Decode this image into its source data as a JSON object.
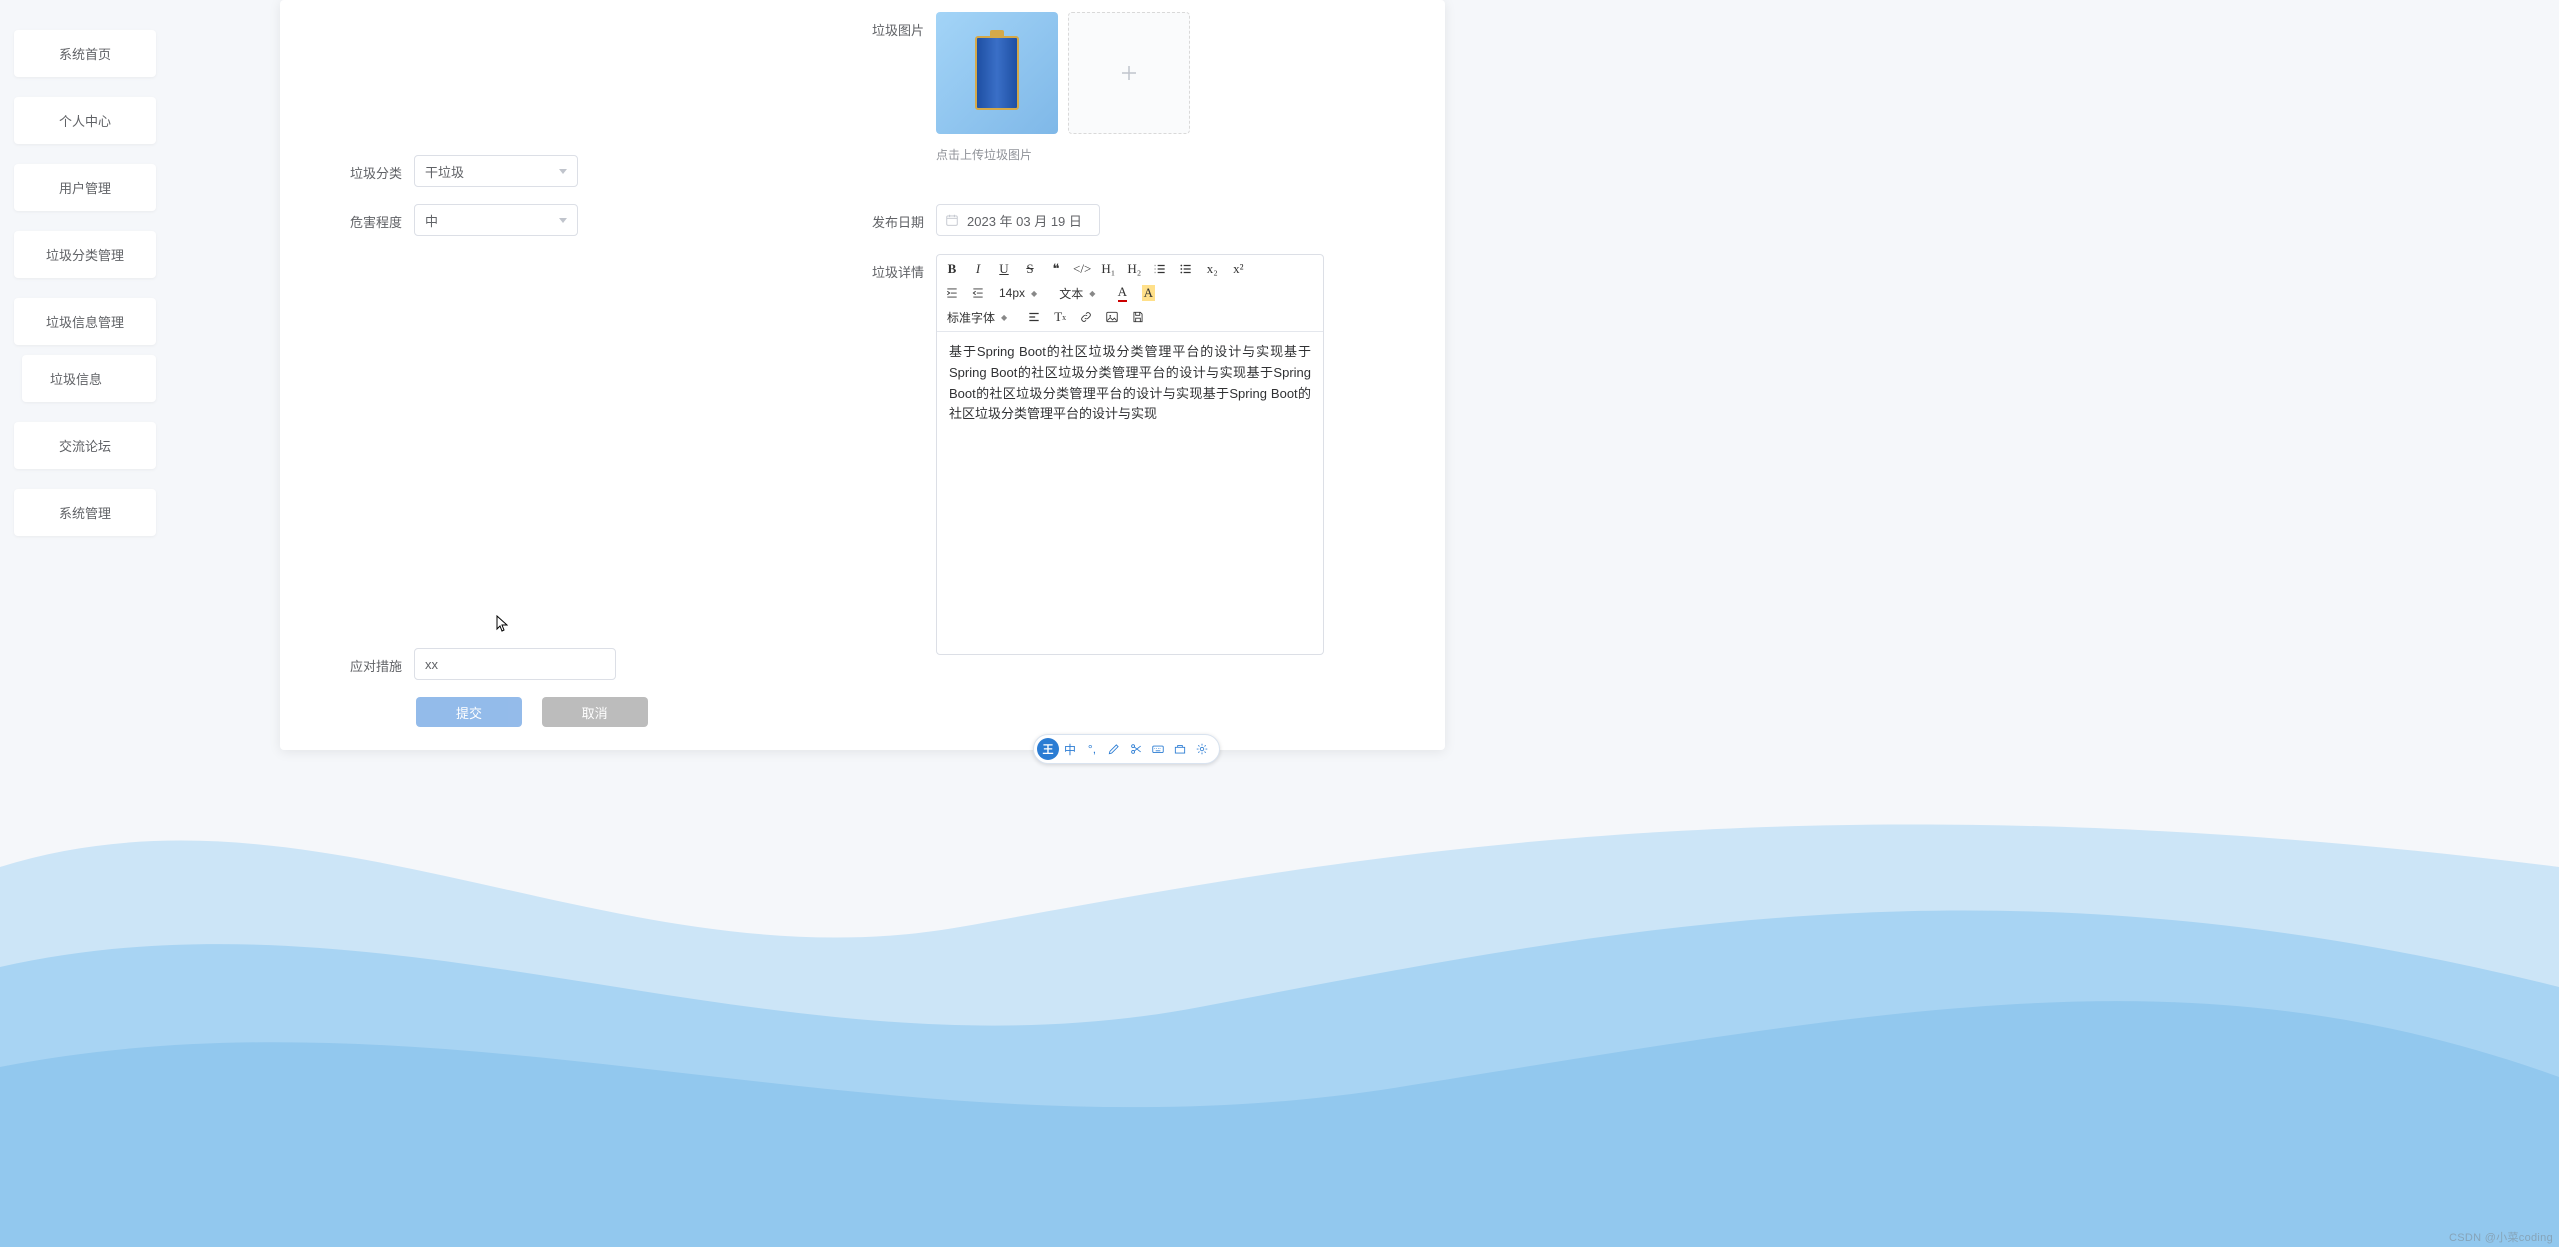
{
  "sidebar": {
    "items": [
      {
        "label": "系统首页"
      },
      {
        "label": "个人中心"
      },
      {
        "label": "用户管理"
      },
      {
        "label": "垃圾分类管理"
      },
      {
        "label": "垃圾信息管理"
      },
      {
        "label": "交流论坛"
      },
      {
        "label": "系统管理"
      }
    ],
    "subItem": {
      "label": "垃圾信息"
    }
  },
  "form": {
    "labels": {
      "image": "垃圾图片",
      "category": "垃圾分类",
      "danger": "危害程度",
      "date": "发布日期",
      "detail": "垃圾详情",
      "measure": "应对措施"
    },
    "categoryValue": "干垃圾",
    "dangerValue": "中",
    "dateValue": "2023 年 03 月 19 日",
    "uploadHint": "点击上传垃圾图片",
    "measureValue": "xx",
    "editorContent": "基于Spring Boot的社区垃圾分类管理平台的设计与实现基于Spring Boot的社区垃圾分类管理平台的设计与实现基于Spring Boot的社区垃圾分类管理平台的设计与实现基于Spring Boot的社区垃圾分类管理平台的设计与实现"
  },
  "editorToolbar": {
    "fontSize": "14px",
    "textType": "文本",
    "fontFamily": "标准字体",
    "h1": "H₁",
    "h2": "H₂",
    "sub": "x₂",
    "sup": "x²"
  },
  "actions": {
    "submit": "提交",
    "cancel": "取消"
  },
  "ime": {
    "logo": "王",
    "lang": "中"
  },
  "watermark": "CSDN @小菜coding"
}
